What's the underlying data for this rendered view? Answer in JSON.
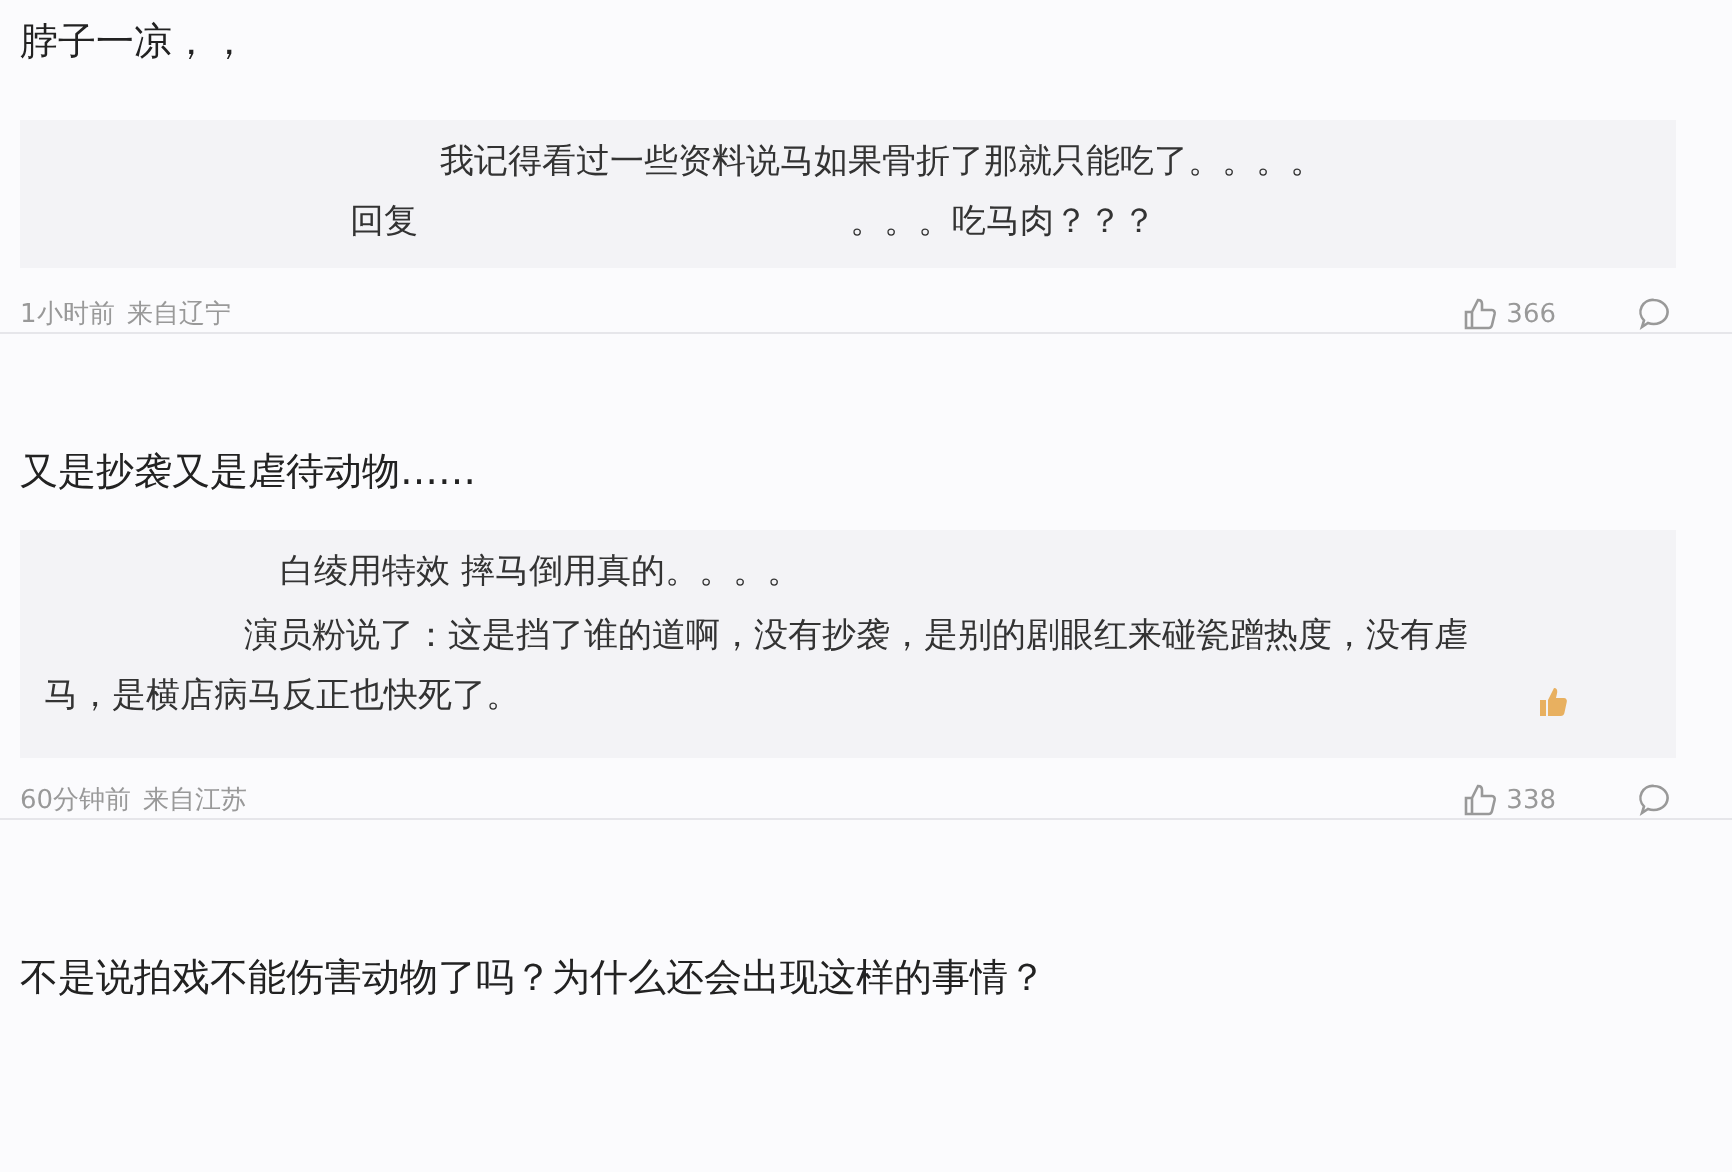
{
  "comments": [
    {
      "text": "脖子一凉，，",
      "quote": {
        "lines": [
          [
            "我记得看过一些资料说马如果骨折了那就只能吃了。。。。"
          ],
          [
            "回复",
            "。。。吃马肉？？？"
          ]
        ],
        "thumb_emoji": false
      },
      "time": "1小时前",
      "location": "来自辽宁",
      "likes": "366"
    },
    {
      "text": "又是抄袭又是虐待动物……",
      "quote": {
        "lines": [
          [
            "白绫用特效 摔马倒用真的。。。。"
          ],
          [
            "演员粉说了：这是挡了谁的道啊，没有抄袭，是别的剧眼红来碰瓷蹭热度，没有虐马，是横店病马反正也快死了。"
          ]
        ],
        "thumb_emoji": true
      },
      "time": "60分钟前",
      "location": "来自江苏",
      "likes": "338"
    },
    {
      "text": "不是说拍戏不能伤害动物了吗？为什么还会出现这样的事情？"
    }
  ]
}
